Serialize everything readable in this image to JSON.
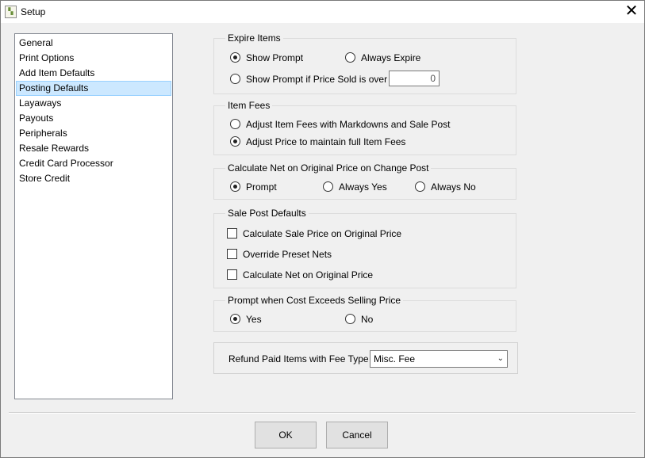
{
  "window": {
    "title": "Setup",
    "icon": "setup-app-icon",
    "close_glyph": "✕"
  },
  "nav": {
    "selected": "Posting Defaults",
    "items": [
      {
        "label": "General"
      },
      {
        "label": "Print Options"
      },
      {
        "label": "Add Item Defaults"
      },
      {
        "label": "Posting Defaults"
      },
      {
        "label": "Layaways"
      },
      {
        "label": "Payouts"
      },
      {
        "label": "Peripherals"
      },
      {
        "label": "Resale Rewards"
      },
      {
        "label": "Credit Card Processor"
      },
      {
        "label": "Store Credit"
      }
    ]
  },
  "expire_items": {
    "title": "Expire Items",
    "show_prompt": "Show Prompt",
    "always_expire": "Always Expire",
    "show_prompt_if_price": "Show Prompt if Price Sold is over",
    "price_threshold": "0",
    "selected": "Show Prompt"
  },
  "item_fees": {
    "title": "Item Fees",
    "adjust_fees": "Adjust Item Fees with Markdowns and Sale Post",
    "adjust_price": "Adjust Price to maintain full Item Fees",
    "selected": "Adjust Price to maintain full Item Fees"
  },
  "calc_net": {
    "title": "Calculate Net on Original Price on Change Post",
    "prompt": "Prompt",
    "always_yes": "Always Yes",
    "always_no": "Always No",
    "selected": "Prompt"
  },
  "sale_post": {
    "title": "Sale Post Defaults",
    "calc_sale_price": "Calculate Sale Price on Original Price",
    "override_nets": "Override Preset Nets",
    "calc_net_original": "Calculate Net on Original Price",
    "checked": []
  },
  "cost_exceeds": {
    "title": "Prompt when Cost Exceeds Selling Price",
    "yes": "Yes",
    "no": "No",
    "selected": "Yes"
  },
  "refund": {
    "label": "Refund Paid Items with Fee Type",
    "value": "Misc. Fee"
  },
  "buttons": {
    "ok": "OK",
    "cancel": "Cancel"
  }
}
